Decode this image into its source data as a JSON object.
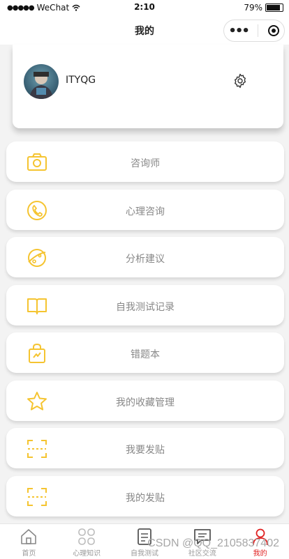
{
  "status": {
    "carrier": "WeChat",
    "time": "2:10",
    "battery": "79%"
  },
  "nav": {
    "title": "我的"
  },
  "profile": {
    "username": "ITYQG"
  },
  "menu": [
    {
      "label": "咨询师",
      "icon": "camera-icon"
    },
    {
      "label": "心理咨询",
      "icon": "phone-icon"
    },
    {
      "label": "分析建议",
      "icon": "planet-icon"
    },
    {
      "label": "自我测试记录",
      "icon": "book-icon"
    },
    {
      "label": "错题本",
      "icon": "bag-icon"
    },
    {
      "label": "我的收藏管理",
      "icon": "star-icon"
    },
    {
      "label": "我要发贴",
      "icon": "scan-icon"
    },
    {
      "label": "我的发贴",
      "icon": "scan-icon"
    }
  ],
  "tabs": [
    {
      "label": "首页",
      "icon": "home-icon"
    },
    {
      "label": "心理知识",
      "icon": "grid-icon"
    },
    {
      "label": "自我测试",
      "icon": "test-icon"
    },
    {
      "label": "社区交流",
      "icon": "chat-icon"
    },
    {
      "label": "我的",
      "icon": "user-icon",
      "active": true
    }
  ],
  "watermark": "CSDN @QQ_2105837402",
  "colors": {
    "accent": "#f5c430",
    "active_tab": "#e02020",
    "label_gray": "#888888"
  }
}
